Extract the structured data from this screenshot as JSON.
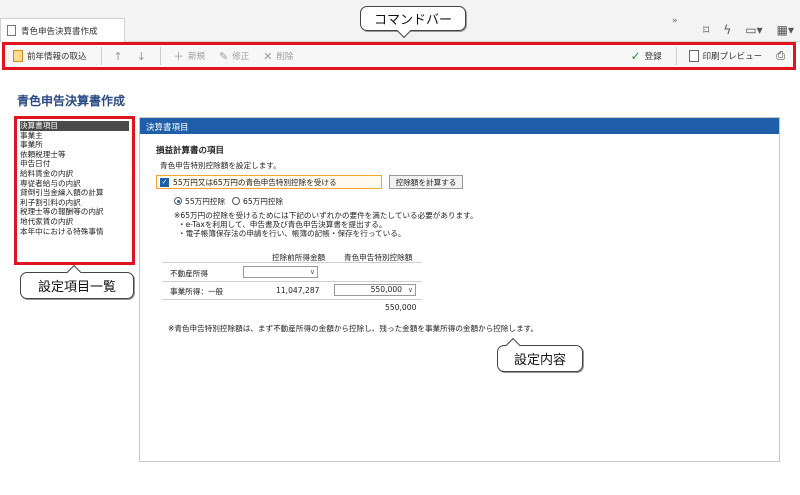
{
  "tab": {
    "label": "青色申告決算書作成"
  },
  "toolbar": {
    "import_label": "前年情報の取込",
    "new_label": "新規",
    "edit_label": "修正",
    "delete_label": "削除",
    "register_label": "登録",
    "print_preview_label": "印刷プレビュー"
  },
  "callouts": {
    "command_bar": "コマンドバー",
    "settings_list": "設定項目一覧",
    "settings_content": "設定内容"
  },
  "page_title": "青色申告決算書作成",
  "left_list": {
    "items": [
      "決算書項目",
      "事業主",
      "事業所",
      "依頼税理士等",
      "申告日付",
      "給料賃金の内訳",
      "専従者給与の内訳",
      "貸倒引当金繰入額の計算",
      "利子割引料の内訳",
      "税理士等の報酬等の内訳",
      "地代家賃の内訳",
      "本年中における特殊事情"
    ],
    "selected_index": 0
  },
  "panel": {
    "header": "決算書項目",
    "section_title": "損益計算書の項目",
    "description": "青色申告特別控除額を設定します。",
    "checkbox_label": "55万円又は65万円の青色申告特別控除を受ける",
    "calc_button": "控除額を計算する",
    "radio_55": "55万円控除",
    "radio_65": "65万円控除",
    "note1": "※65万円の控除を受けるためには下記のいずれかの要件を満たしている必要があります。",
    "note2": "・e-Taxを利用して、申告書及び青色申告決算書を提出する。",
    "note3": "・電子帳簿保存法の申請を行い、帳簿の記帳・保存を行っている。",
    "col_before": "控除前所得金額",
    "col_deduction": "青色申告特別控除額",
    "row1_label": "不動産所得",
    "row2_label": "事業所得：一般",
    "row2_before": "11,047,287",
    "row2_deduction": "550,000",
    "total": "550,000",
    "footnote": "※青色申告特別控除額は、まず不動産所得の金額から控除し、残った金額を事業所得の金額から控除します。"
  }
}
